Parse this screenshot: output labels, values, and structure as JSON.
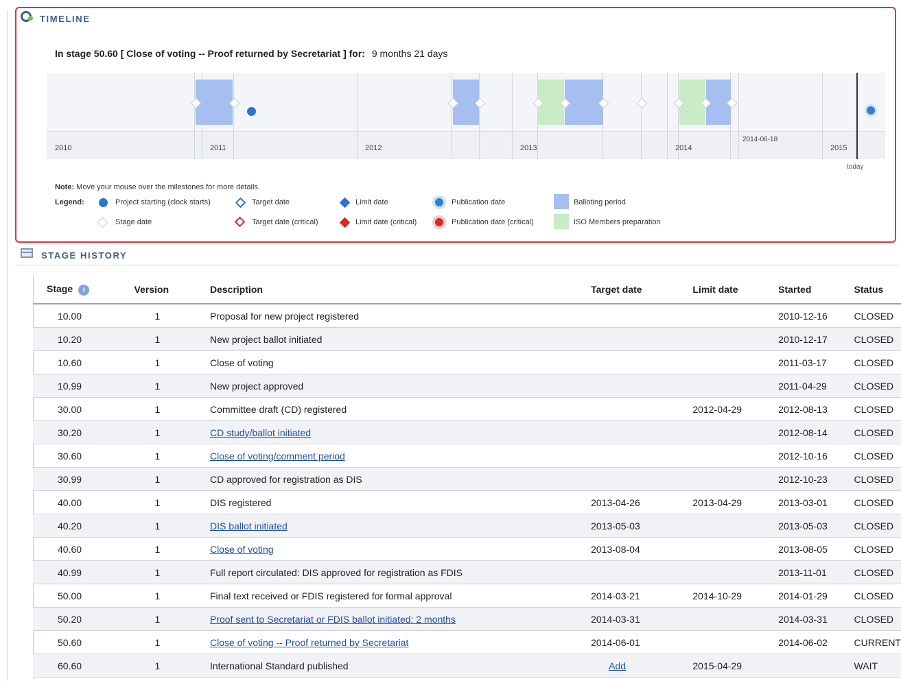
{
  "timeline": {
    "title": "TIMELINE",
    "stage_prefix": "In stage 50.60 [ Close of voting -- Proof returned by Secretariat ] for:",
    "stage_duration": "9 months 21 days",
    "years": [
      "2010",
      "2011",
      "2012",
      "2013",
      "2014",
      "2015"
    ],
    "date_callout": "2014-06-18",
    "today_label": "today",
    "colors": {
      "ballot": "#a6bff1",
      "iso": "#c9ecc6",
      "dot": "#2f72d6",
      "critical": "#d42a2a"
    }
  },
  "legend": {
    "note_bold": "Note:",
    "note_text": "Move your mouse over the milestones for more details.",
    "label": "Legend:",
    "items": [
      "Project starting (clock starts)",
      "Target date",
      "Limit date",
      "Publication date",
      "Balloting period",
      "Stage date",
      "Target date (critical)",
      "Limit date (critical)",
      "Publication date (critical)",
      "ISO Members preparation"
    ]
  },
  "stage_history": {
    "title": "STAGE HISTORY",
    "info_icon": "i",
    "headers": {
      "stage": "Stage",
      "version": "Version",
      "description": "Description",
      "target": "Target date",
      "limit": "Limit date",
      "started": "Started",
      "status": "Status"
    },
    "rows": [
      {
        "stage": "10.00",
        "version": "1",
        "description": "Proposal for new project registered",
        "target": "",
        "limit": "",
        "started": "2010-12-16",
        "status": "CLOSED"
      },
      {
        "stage": "10.20",
        "version": "1",
        "description": "New project ballot initiated",
        "target": "",
        "limit": "",
        "started": "2010-12-17",
        "status": "CLOSED"
      },
      {
        "stage": "10.60",
        "version": "1",
        "description": "Close of voting",
        "target": "",
        "limit": "",
        "started": "2011-03-17",
        "status": "CLOSED"
      },
      {
        "stage": "10.99",
        "version": "1",
        "description": "New project approved",
        "target": "",
        "limit": "",
        "started": "2011-04-29",
        "status": "CLOSED"
      },
      {
        "stage": "30.00",
        "version": "1",
        "description": "Committee draft (CD) registered",
        "target": "",
        "limit": "2012-04-29",
        "started": "2012-08-13",
        "status": "CLOSED"
      },
      {
        "stage": "30.20",
        "version": "1",
        "description": "CD study/ballot initiated",
        "target": "",
        "limit": "",
        "started": "2012-08-14",
        "status": "CLOSED"
      },
      {
        "stage": "30.60",
        "version": "1",
        "description": "Close of voting/comment period",
        "target": "",
        "limit": "",
        "started": "2012-10-16",
        "status": "CLOSED"
      },
      {
        "stage": "30.99",
        "version": "1",
        "description": "CD approved for registration as DIS",
        "target": "",
        "limit": "",
        "started": "2012-10-23",
        "status": "CLOSED"
      },
      {
        "stage": "40.00",
        "version": "1",
        "description": "DIS registered",
        "target": "2013-04-26",
        "limit": "2013-04-29",
        "started": "2013-03-01",
        "status": "CLOSED"
      },
      {
        "stage": "40.20",
        "version": "1",
        "description": "DIS ballot initiated",
        "target": "2013-05-03",
        "limit": "",
        "started": "2013-05-03",
        "status": "CLOSED"
      },
      {
        "stage": "40.60",
        "version": "1",
        "description": "Close of voting",
        "target": "2013-08-04",
        "limit": "",
        "started": "2013-08-05",
        "status": "CLOSED"
      },
      {
        "stage": "40.99",
        "version": "1",
        "description": "Full report circulated: DIS approved for registration as FDIS",
        "target": "",
        "limit": "",
        "started": "2013-11-01",
        "status": "CLOSED"
      },
      {
        "stage": "50.00",
        "version": "1",
        "description": "Final text received or FDIS registered for formal approval",
        "target": "2014-03-21",
        "limit": "2014-10-29",
        "started": "2014-01-29",
        "status": "CLOSED"
      },
      {
        "stage": "50.20",
        "version": "1",
        "description": "Proof sent to Secretariat or FDIS ballot initiated: 2 months",
        "target": "2014-03-31",
        "limit": "",
        "started": "2014-03-31",
        "status": "CLOSED"
      },
      {
        "stage": "50.60",
        "version": "1",
        "description": "Close of voting -- Proof returned by Secretariat",
        "target": "2014-06-01",
        "limit": "",
        "started": "2014-06-02",
        "status": "CURRENT"
      },
      {
        "stage": "60.60",
        "version": "1",
        "description": "International Standard published",
        "target": "Add",
        "limit": "2015-04-29",
        "started": "",
        "status": "WAIT"
      }
    ]
  }
}
